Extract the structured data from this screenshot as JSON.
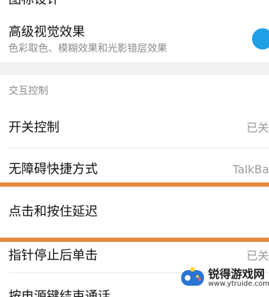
{
  "top_cutoff": {
    "title_partial": "图标设计"
  },
  "visual_effects": {
    "title": "高级视觉效果",
    "subtitle": "色彩取色、模糊效果和光影错层效果",
    "toggle": "on",
    "toggle_color": "#1fa0e6"
  },
  "section": {
    "header": "交互控制"
  },
  "settings": [
    {
      "title": "开关控制",
      "value": "已关"
    },
    {
      "title": "无障碍快捷方式",
      "value": "TalkBa"
    },
    {
      "title": "点击和按住延迟",
      "value": ""
    },
    {
      "title": "指针停止后单击",
      "value": "已关"
    },
    {
      "title": "按电源键结束通话",
      "value": ""
    }
  ],
  "highlight_color": "#e58a3d",
  "watermark": {
    "text": "锐得游戏网",
    "url": "www.ytruide.com"
  }
}
